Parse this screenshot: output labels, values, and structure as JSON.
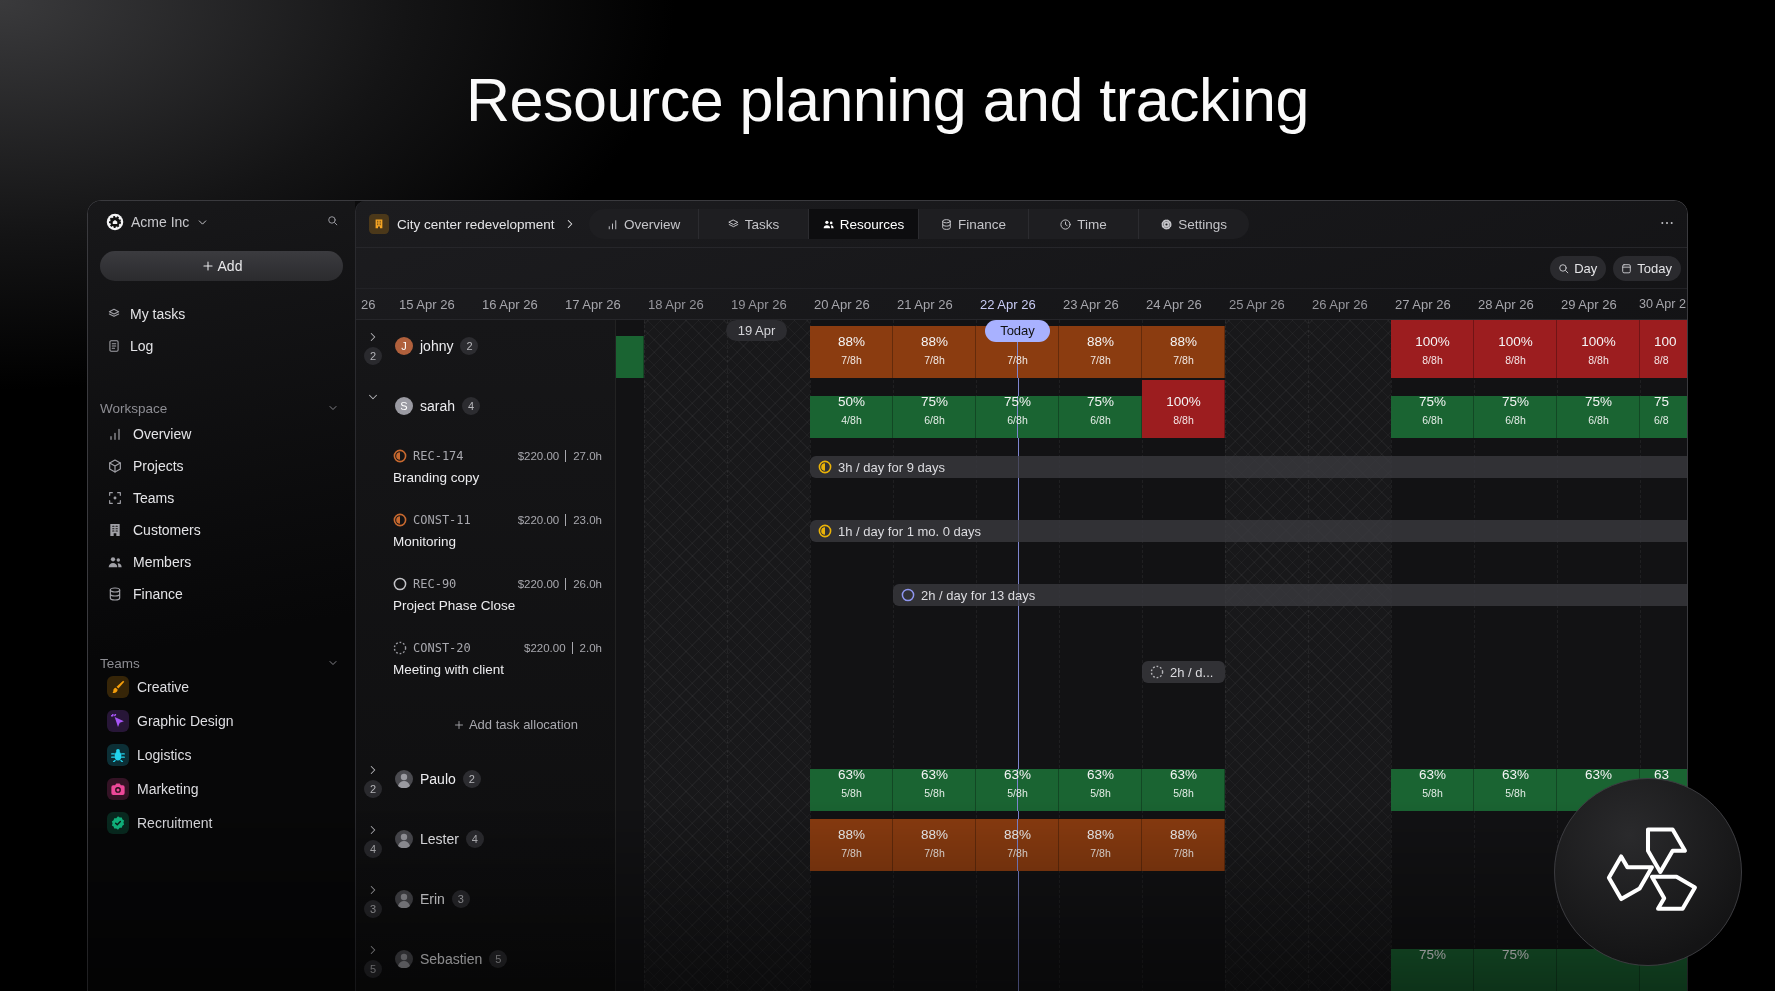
{
  "heading": "Resource planning and tracking",
  "sidebar": {
    "workspace": "Acme Inc",
    "add_button": "Add",
    "items": [
      {
        "label": "My tasks"
      },
      {
        "label": "Log"
      }
    ],
    "sections": [
      {
        "title": "Workspace",
        "kind": "nav",
        "expanded": true,
        "items": [
          {
            "label": "Overview"
          },
          {
            "label": "Projects"
          },
          {
            "label": "Teams"
          },
          {
            "label": "Customers"
          },
          {
            "label": "Members"
          },
          {
            "label": "Finance"
          }
        ]
      },
      {
        "title": "Teams",
        "kind": "teams",
        "expanded": true,
        "items": [
          {
            "label": "Creative",
            "color": "#f59e0b"
          },
          {
            "label": "Graphic Design",
            "color": "#a855f7"
          },
          {
            "label": "Logistics",
            "color": "#22d3ee"
          },
          {
            "label": "Marketing",
            "color": "#ec4899"
          },
          {
            "label": "Recruitment",
            "color": "#10b981"
          }
        ]
      }
    ]
  },
  "project": {
    "name": "City center redevelopment"
  },
  "tabs": [
    {
      "label": "Overview",
      "selected": false
    },
    {
      "label": "Tasks",
      "selected": false
    },
    {
      "label": "Resources",
      "selected": true
    },
    {
      "label": "Finance",
      "selected": false
    },
    {
      "label": "Time",
      "selected": false
    },
    {
      "label": "Settings",
      "selected": false
    }
  ],
  "toolbar": {
    "zoom": "Day",
    "today": "Today"
  },
  "dates": [
    {
      "label": "26",
      "weekend": false,
      "today": false
    },
    {
      "label": "15 Apr 26",
      "weekend": false,
      "today": false
    },
    {
      "label": "16 Apr 26",
      "weekend": false,
      "today": false
    },
    {
      "label": "17 Apr 26",
      "weekend": false,
      "today": false
    },
    {
      "label": "18 Apr 26",
      "weekend": true,
      "today": false
    },
    {
      "label": "19 Apr 26",
      "weekend": true,
      "today": false,
      "marker": "19 Apr"
    },
    {
      "label": "20 Apr 26",
      "weekend": false,
      "today": false
    },
    {
      "label": "21 Apr 26",
      "weekend": false,
      "today": false
    },
    {
      "label": "22 Apr 26",
      "weekend": false,
      "today": true,
      "today_label": "Today"
    },
    {
      "label": "23 Apr 26",
      "weekend": false,
      "today": false
    },
    {
      "label": "24 Apr 26",
      "weekend": false,
      "today": false
    },
    {
      "label": "25 Apr 26",
      "weekend": true,
      "today": false
    },
    {
      "label": "26 Apr 26",
      "weekend": true,
      "today": false
    },
    {
      "label": "27 Apr 26",
      "weekend": false,
      "today": false
    },
    {
      "label": "28 Apr 26",
      "weekend": false,
      "today": false
    },
    {
      "label": "29 Apr 26",
      "weekend": false,
      "today": false
    },
    {
      "label": "30 Apr 2",
      "weekend": false,
      "today": false
    }
  ],
  "people": [
    {
      "name": "johny",
      "avatar": {
        "kind": "initial",
        "text": "J",
        "color": "#b0603c"
      },
      "count": "2",
      "expanded": false,
      "collapsed_count": "2",
      "cells": [
        null,
        null,
        null,
        {
          "kind": "ok"
        },
        null,
        null,
        {
          "kind": "high",
          "percent": "88%",
          "hours": "7/8h"
        },
        {
          "kind": "high",
          "percent": "88%",
          "hours": "7/8h"
        },
        {
          "kind": "high",
          "hours": "7/8h"
        },
        {
          "kind": "high",
          "percent": "88%",
          "hours": "7/8h"
        },
        {
          "kind": "high",
          "percent": "88%",
          "hours": "7/8h"
        },
        null,
        null,
        {
          "kind": "over",
          "percent": "100%",
          "hours": "8/8h"
        },
        {
          "kind": "over",
          "percent": "100%",
          "hours": "8/8h"
        },
        {
          "kind": "over",
          "percent": "100%",
          "hours": "8/8h"
        },
        {
          "kind": "over",
          "percent": "100",
          "hours": "8/8"
        }
      ]
    },
    {
      "name": "sarah",
      "avatar": {
        "kind": "initial",
        "text": "S",
        "color": "#9a9aa2"
      },
      "count": "4",
      "expanded": true,
      "cells": [
        null,
        null,
        null,
        null,
        null,
        null,
        {
          "kind": "ok",
          "percent": "50%",
          "hours": "4/8h"
        },
        {
          "kind": "ok",
          "percent": "75%",
          "hours": "6/8h"
        },
        {
          "kind": "ok",
          "percent": "75%",
          "hours": "6/8h"
        },
        {
          "kind": "ok",
          "percent": "75%",
          "hours": "6/8h"
        },
        {
          "kind": "over",
          "percent": "100%",
          "hours": "8/8h"
        },
        null,
        null,
        {
          "kind": "ok",
          "percent": "75%",
          "hours": "6/8h"
        },
        {
          "kind": "ok",
          "percent": "75%",
          "hours": "6/8h"
        },
        {
          "kind": "ok",
          "percent": "75%",
          "hours": "6/8h"
        },
        {
          "kind": "ok",
          "percent": "75",
          "hours": "6/8"
        }
      ],
      "tasks": [
        {
          "key": "REC-174",
          "title": "Branding copy",
          "price": "$220.00",
          "hours": "27.0h",
          "kind": "in_progress",
          "allocation": {
            "label": "3h / day for 9 days",
            "days": [
              false,
              false,
              false,
              true,
              true,
              true,
              true,
              true,
              true,
              true,
              true,
              true,
              true,
              true
            ]
          }
        },
        {
          "key": "CONST-11",
          "title": "Monitoring",
          "price": "$220.00",
          "hours": "23.0h",
          "kind": "in_progress",
          "allocation": {
            "label": "1h / day for 1 mo. 0 days",
            "days": [
              false,
              false,
              false,
              true,
              true,
              true,
              true,
              true,
              true,
              true,
              true,
              true,
              true,
              true
            ]
          }
        },
        {
          "key": "REC-90",
          "title": "Project Phase Close",
          "price": "$220.00",
          "hours": "26.0h",
          "kind": "todo",
          "allocation": {
            "label": "2h / day for 13 days",
            "days": [
              false,
              false,
              false,
              false,
              true,
              true,
              true,
              true,
              true,
              true,
              true,
              true,
              true,
              true
            ]
          }
        },
        {
          "key": "CONST-20",
          "title": "Meeting with client",
          "price": "$220.00",
          "hours": "2.0h",
          "kind": "backlog",
          "allocation": {
            "label": "2h / d...",
            "days": [
              false,
              false,
              false,
              false,
              false,
              false,
              false,
              true,
              false,
              false,
              false,
              false,
              false,
              false
            ]
          }
        }
      ],
      "add_allocation": "Add task allocation"
    },
    {
      "name": "Paulo",
      "avatar": {
        "kind": "photo"
      },
      "count": "2",
      "expanded": false,
      "collapsed_count": "2",
      "cells": [
        null,
        null,
        null,
        null,
        null,
        null,
        {
          "kind": "ok",
          "percent": "63%",
          "hours": "5/8h"
        },
        {
          "kind": "ok",
          "percent": "63%",
          "hours": "5/8h"
        },
        {
          "kind": "ok",
          "percent": "63%",
          "hours": "5/8h"
        },
        {
          "kind": "ok",
          "percent": "63%",
          "hours": "5/8h"
        },
        {
          "kind": "ok",
          "percent": "63%",
          "hours": "5/8h"
        },
        null,
        null,
        {
          "kind": "ok",
          "percent": "63%",
          "hours": "5/8h"
        },
        {
          "kind": "ok",
          "percent": "63%",
          "hours": "5/8h"
        },
        {
          "kind": "ok",
          "percent": "63%"
        },
        {
          "kind": "ok",
          "percent": "63"
        }
      ]
    },
    {
      "name": "Lester",
      "avatar": {
        "kind": "photo"
      },
      "count": "4",
      "expanded": false,
      "collapsed_count": "4",
      "cells": [
        null,
        null,
        null,
        null,
        null,
        null,
        {
          "kind": "high",
          "percent": "88%",
          "hours": "7/8h"
        },
        {
          "kind": "high",
          "percent": "88%",
          "hours": "7/8h"
        },
        {
          "kind": "high",
          "percent": "88%",
          "hours": "7/8h"
        },
        {
          "kind": "high",
          "percent": "88%",
          "hours": "7/8h"
        },
        {
          "kind": "high",
          "percent": "88%",
          "hours": "7/8h"
        }
      ]
    },
    {
      "name": "Erin",
      "avatar": {
        "kind": "photo"
      },
      "count": "3",
      "expanded": false,
      "collapsed_count": "3"
    },
    {
      "name": "Sebastien",
      "avatar": {
        "kind": "photo"
      },
      "count": "5",
      "expanded": false,
      "collapsed_count": "5",
      "cells": [
        null,
        null,
        null,
        null,
        null,
        null,
        null,
        null,
        null,
        null,
        null,
        null,
        null,
        {
          "kind": "ok",
          "percent": "75%"
        },
        {
          "kind": "ok",
          "percent": "75%"
        },
        {
          "kind": "ok"
        },
        {
          "kind": "ok"
        }
      ]
    }
  ]
}
